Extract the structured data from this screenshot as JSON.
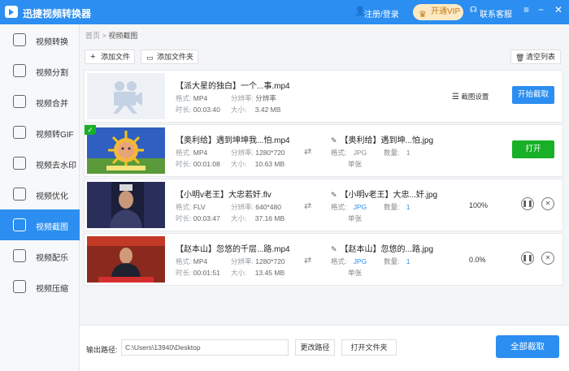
{
  "app": {
    "title": "迅捷视频转换器",
    "login": "注册/登录",
    "vip": "开通VIP",
    "service": "联系客服"
  },
  "sidebar": {
    "items": [
      {
        "label": "视频转换"
      },
      {
        "label": "视频分割"
      },
      {
        "label": "视频合并"
      },
      {
        "label": "视频转GIF"
      },
      {
        "label": "视频去水印"
      },
      {
        "label": "视频优化"
      },
      {
        "label": "视频截图"
      },
      {
        "label": "视频配乐"
      },
      {
        "label": "视频压缩"
      }
    ]
  },
  "breadcrumb": {
    "home": "首页",
    "sep": ">",
    "current": "视频截图"
  },
  "toolbar": {
    "add_file": "添加文件",
    "add_folder": "添加文件夹",
    "clear": "清空列表"
  },
  "labels": {
    "format": "格式:",
    "resolution": "分辨率:",
    "duration": "时长:",
    "size": "大小:",
    "count": "数量:"
  },
  "rows": [
    {
      "name": "【派大星的独白】一个...事.mp4",
      "format": "MP4",
      "resolution": "分辨率",
      "duration": "00:03:40",
      "size": "3.42 MB",
      "settings": "截图设置",
      "action": "开始截取"
    },
    {
      "name": "【奥利给】遇到坤坤我...怕.mp4",
      "format": "MP4",
      "resolution": "1280*720",
      "duration": "00:01:08",
      "size": "10.63 MB",
      "out_name": "【奥利给】遇到坤...怕.jpg",
      "out_format": "JPG",
      "out_count": "1",
      "out_mode": "单张",
      "action": "打开"
    },
    {
      "name": "【小明v老王】大忠若奸.flv",
      "format": "FLV",
      "resolution": "640*480",
      "duration": "00:03:47",
      "size": "37.16 MB",
      "out_name": "【小明v老王】大忠...奸.jpg",
      "out_format": "JPG",
      "out_count": "1",
      "out_mode": "单张",
      "progress": "100%"
    },
    {
      "name": "【赵本山】忽悠的千层...路.mp4",
      "format": "MP4",
      "resolution": "1280*720",
      "duration": "00:01:51",
      "size": "13.45 MB",
      "out_name": "【赵本山】忽悠的...路.jpg",
      "out_format": "JPG",
      "out_count": "1",
      "out_mode": "单张",
      "progress": "0.0%"
    }
  ],
  "bottom": {
    "output_label": "输出路径:",
    "path": "C:\\Users\\13940\\Desktop",
    "change_path": "更改路径",
    "open_folder": "打开文件夹",
    "start_all": "全部截取"
  },
  "colors": {
    "accent": "#2b8ef0",
    "success": "#17b026",
    "vip": "#fde9c4"
  }
}
